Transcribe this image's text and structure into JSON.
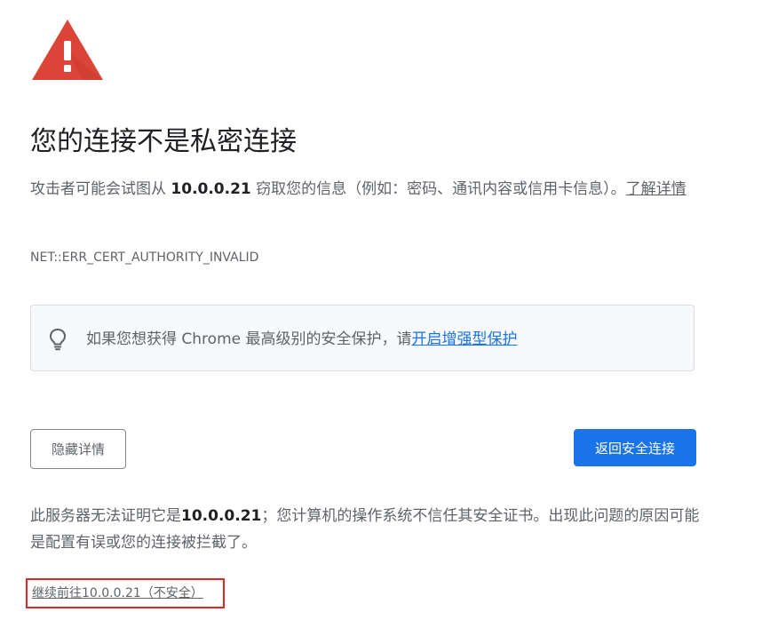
{
  "page": {
    "title": "您的连接不是私密连接",
    "description": {
      "prefix": "攻击者可能会试图从 ",
      "host": "10.0.0.21",
      "suffix": " 窃取您的信息（例如：密码、通讯内容或信用卡信息）。",
      "learn_more": "了解详情"
    },
    "error_code": "NET::ERR_CERT_AUTHORITY_INVALID"
  },
  "enhanced_protection": {
    "icon": "lightbulb-icon",
    "text": "如果您想获得 Chrome 最高级别的安全保护，请",
    "link": "开启增强型保护"
  },
  "buttons": {
    "hide_details": "隐藏详情",
    "back_to_safety": "返回安全连接"
  },
  "details": {
    "prefix": "此服务器无法证明它是",
    "host": "10.0.0.21",
    "suffix": "；您计算机的操作系统不信任其安全证书。出现此问题的原因可能是配置有误或您的连接被拦截了。"
  },
  "proceed_link": "继续前往10.0.0.21（不安全）",
  "colors": {
    "warning_red": "#db4437",
    "primary_blue": "#1a73e8",
    "text_primary": "#202124",
    "text_secondary": "#5f6368",
    "highlight_box": "#e0242a"
  }
}
